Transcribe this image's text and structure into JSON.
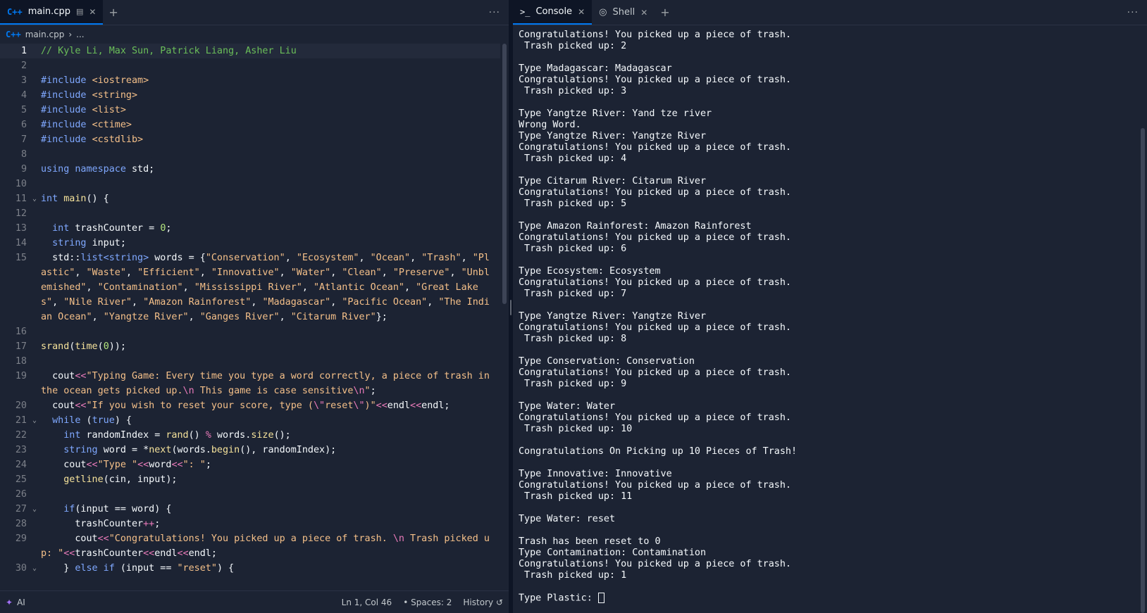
{
  "editor": {
    "tab": {
      "label": "main.cpp",
      "icon": "cpp-file-icon"
    },
    "breadcrumb": {
      "file": "main.cpp",
      "rest": "..."
    },
    "status": {
      "ai_label": "AI",
      "position": "Ln 1, Col 46",
      "spaces": "Spaces: 2",
      "history": "History"
    },
    "lines": [
      {
        "n": "1",
        "fold": false,
        "segs": [
          [
            "com",
            "// Kyle Li, Max Sun, Patrick Liang, Asher Liu"
          ]
        ]
      },
      {
        "n": "2",
        "fold": false,
        "segs": []
      },
      {
        "n": "3",
        "fold": false,
        "segs": [
          [
            "inc",
            "#include "
          ],
          [
            "hdr",
            "<iostream>"
          ]
        ]
      },
      {
        "n": "4",
        "fold": false,
        "segs": [
          [
            "inc",
            "#include "
          ],
          [
            "hdr",
            "<string>"
          ]
        ]
      },
      {
        "n": "5",
        "fold": false,
        "segs": [
          [
            "inc",
            "#include "
          ],
          [
            "hdr",
            "<list>"
          ]
        ]
      },
      {
        "n": "6",
        "fold": false,
        "segs": [
          [
            "inc",
            "#include "
          ],
          [
            "hdr",
            "<ctime>"
          ]
        ]
      },
      {
        "n": "7",
        "fold": false,
        "segs": [
          [
            "inc",
            "#include "
          ],
          [
            "hdr",
            "<cstdlib>"
          ]
        ]
      },
      {
        "n": "8",
        "fold": false,
        "segs": []
      },
      {
        "n": "9",
        "fold": false,
        "segs": [
          [
            "kw",
            "using namespace "
          ],
          [
            "",
            "std;"
          ]
        ]
      },
      {
        "n": "10",
        "fold": false,
        "segs": []
      },
      {
        "n": "11",
        "fold": true,
        "segs": [
          [
            "kw",
            "int "
          ],
          [
            "fn",
            "main"
          ],
          [
            "",
            "() {"
          ]
        ]
      },
      {
        "n": "12",
        "fold": false,
        "segs": []
      },
      {
        "n": "13",
        "fold": false,
        "segs": [
          [
            "",
            "  "
          ],
          [
            "kw",
            "int "
          ],
          [
            "",
            "trashCounter = "
          ],
          [
            "num",
            "0"
          ],
          [
            "",
            ";"
          ]
        ]
      },
      {
        "n": "14",
        "fold": false,
        "segs": [
          [
            "",
            "  "
          ],
          [
            "kw",
            "string "
          ],
          [
            "",
            "input;"
          ]
        ]
      },
      {
        "n": "15",
        "fold": false,
        "segs": [
          [
            "",
            "  std::"
          ],
          [
            "type",
            "list<string> "
          ],
          [
            "",
            "words = {"
          ],
          [
            "str",
            "\"Conservation\""
          ],
          [
            "",
            ", "
          ],
          [
            "str",
            "\"Ecosystem\""
          ],
          [
            "",
            ", "
          ],
          [
            "str",
            "\"Ocean\""
          ],
          [
            "",
            ", "
          ],
          [
            "str",
            "\"Trash\""
          ],
          [
            "",
            ", "
          ],
          [
            "str",
            "\"Plastic\""
          ],
          [
            "",
            ", "
          ],
          [
            "str",
            "\"Waste\""
          ],
          [
            "",
            ", "
          ],
          [
            "str",
            "\"Efficient\""
          ],
          [
            "",
            ", "
          ],
          [
            "str",
            "\"Innovative\""
          ],
          [
            "",
            ", "
          ],
          [
            "str",
            "\"Water\""
          ],
          [
            "",
            ", "
          ],
          [
            "str",
            "\"Clean\""
          ],
          [
            "",
            ", "
          ],
          [
            "str",
            "\"Preserve\""
          ],
          [
            "",
            ", "
          ],
          [
            "str",
            "\"Unblemished\""
          ],
          [
            "",
            ", "
          ],
          [
            "str",
            "\"Contamination\""
          ],
          [
            "",
            ", "
          ],
          [
            "str",
            "\"Mississippi River\""
          ],
          [
            "",
            ", "
          ],
          [
            "str",
            "\"Atlantic Ocean\""
          ],
          [
            "",
            ", "
          ],
          [
            "str",
            "\"Great Lakes\""
          ],
          [
            "",
            ", "
          ],
          [
            "str",
            "\"Nile River\""
          ],
          [
            "",
            ", "
          ],
          [
            "str",
            "\"Amazon Rainforest\""
          ],
          [
            "",
            ", "
          ],
          [
            "str",
            "\"Madagascar\""
          ],
          [
            "",
            ", "
          ],
          [
            "str",
            "\"Pacific Ocean\""
          ],
          [
            "",
            ", "
          ],
          [
            "str",
            "\"The Indian Ocean\""
          ],
          [
            "",
            ", "
          ],
          [
            "str",
            "\"Yangtze River\""
          ],
          [
            "",
            ", "
          ],
          [
            "str",
            "\"Ganges River\""
          ],
          [
            "",
            ", "
          ],
          [
            "str",
            "\"Citarum River\""
          ],
          [
            "",
            "};"
          ]
        ]
      },
      {
        "n": "16",
        "fold": false,
        "segs": []
      },
      {
        "n": "17",
        "fold": false,
        "segs": [
          [
            "fn",
            "srand"
          ],
          [
            "",
            "("
          ],
          [
            "fn",
            "time"
          ],
          [
            "",
            "("
          ],
          [
            "num",
            "0"
          ],
          [
            "",
            "));"
          ]
        ]
      },
      {
        "n": "18",
        "fold": false,
        "segs": []
      },
      {
        "n": "19",
        "fold": false,
        "segs": [
          [
            "",
            "  cout"
          ],
          [
            "op",
            "<<"
          ],
          [
            "str",
            "\"Typing Game: Every time you type a word correctly, a piece of trash in the ocean gets picked up."
          ],
          [
            "esc",
            "\\n"
          ],
          [
            "str",
            " This game is case sensitive"
          ],
          [
            "esc",
            "\\n"
          ],
          [
            "str",
            "\""
          ],
          [
            "",
            ";"
          ]
        ]
      },
      {
        "n": "20",
        "fold": false,
        "segs": [
          [
            "",
            "  cout"
          ],
          [
            "op",
            "<<"
          ],
          [
            "str",
            "\"If you wish to reset your score, type ("
          ],
          [
            "esc",
            "\\\""
          ],
          [
            "str",
            "reset"
          ],
          [
            "esc",
            "\\\""
          ],
          [
            "str",
            ")\""
          ],
          [
            "op",
            "<<"
          ],
          [
            "",
            "endl"
          ],
          [
            "op",
            "<<"
          ],
          [
            "",
            "endl;"
          ]
        ]
      },
      {
        "n": "21",
        "fold": true,
        "segs": [
          [
            "",
            "  "
          ],
          [
            "kw",
            "while "
          ],
          [
            "",
            "("
          ],
          [
            "kw",
            "true"
          ],
          [
            "",
            ") {"
          ]
        ]
      },
      {
        "n": "22",
        "fold": false,
        "segs": [
          [
            "",
            "    "
          ],
          [
            "kw",
            "int "
          ],
          [
            "",
            "randomIndex = "
          ],
          [
            "fn",
            "rand"
          ],
          [
            "",
            "() "
          ],
          [
            "op",
            "% "
          ],
          [
            "",
            "words."
          ],
          [
            "fn",
            "size"
          ],
          [
            "",
            "();"
          ]
        ]
      },
      {
        "n": "23",
        "fold": false,
        "segs": [
          [
            "",
            "    "
          ],
          [
            "kw",
            "string "
          ],
          [
            "",
            "word = *"
          ],
          [
            "fn",
            "next"
          ],
          [
            "",
            "(words."
          ],
          [
            "fn",
            "begin"
          ],
          [
            "",
            "(), randomIndex);"
          ]
        ]
      },
      {
        "n": "24",
        "fold": false,
        "segs": [
          [
            "",
            "    cout"
          ],
          [
            "op",
            "<<"
          ],
          [
            "str",
            "\"Type \""
          ],
          [
            "op",
            "<<"
          ],
          [
            "",
            "word"
          ],
          [
            "op",
            "<<"
          ],
          [
            "str",
            "\": \""
          ],
          [
            "",
            ";"
          ]
        ]
      },
      {
        "n": "25",
        "fold": false,
        "segs": [
          [
            "",
            "    "
          ],
          [
            "fn",
            "getline"
          ],
          [
            "",
            "(cin, input);"
          ]
        ]
      },
      {
        "n": "26",
        "fold": false,
        "segs": []
      },
      {
        "n": "27",
        "fold": true,
        "segs": [
          [
            "",
            "    "
          ],
          [
            "kw",
            "if"
          ],
          [
            "",
            "(input == word) {"
          ]
        ]
      },
      {
        "n": "28",
        "fold": false,
        "segs": [
          [
            "",
            "      trashCounter"
          ],
          [
            "op",
            "++"
          ],
          [
            "",
            ";"
          ]
        ]
      },
      {
        "n": "29",
        "fold": false,
        "segs": [
          [
            "",
            "      cout"
          ],
          [
            "op",
            "<<"
          ],
          [
            "str",
            "\"Congratulations! You picked up a piece of trash. "
          ],
          [
            "esc",
            "\\n"
          ],
          [
            "str",
            " Trash picked up: \""
          ],
          [
            "op",
            "<<"
          ],
          [
            "",
            "trashCounter"
          ],
          [
            "op",
            "<<"
          ],
          [
            "",
            "endl"
          ],
          [
            "op",
            "<<"
          ],
          [
            "",
            "endl;"
          ]
        ]
      },
      {
        "n": "30",
        "fold": true,
        "segs": [
          [
            "",
            "    } "
          ],
          [
            "kw",
            "else if "
          ],
          [
            "",
            "(input == "
          ],
          [
            "str",
            "\"reset\""
          ],
          [
            "",
            ") {"
          ]
        ]
      }
    ]
  },
  "console": {
    "tabs": [
      {
        "label": "Console",
        "icon": "terminal-icon",
        "active": true
      },
      {
        "label": "Shell",
        "icon": "shell-icon",
        "active": false
      }
    ],
    "lines": [
      "Congratulations! You picked up a piece of trash.",
      " Trash picked up: 2",
      "",
      "Type Madagascar: Madagascar",
      "Congratulations! You picked up a piece of trash.",
      " Trash picked up: 3",
      "",
      "Type Yangtze River: Yand tze river",
      "Wrong Word.",
      "Type Yangtze River: Yangtze River",
      "Congratulations! You picked up a piece of trash.",
      " Trash picked up: 4",
      "",
      "Type Citarum River: Citarum River",
      "Congratulations! You picked up a piece of trash.",
      " Trash picked up: 5",
      "",
      "Type Amazon Rainforest: Amazon Rainforest",
      "Congratulations! You picked up a piece of trash.",
      " Trash picked up: 6",
      "",
      "Type Ecosystem: Ecosystem",
      "Congratulations! You picked up a piece of trash.",
      " Trash picked up: 7",
      "",
      "Type Yangtze River: Yangtze River",
      "Congratulations! You picked up a piece of trash.",
      " Trash picked up: 8",
      "",
      "Type Conservation: Conservation",
      "Congratulations! You picked up a piece of trash.",
      " Trash picked up: 9",
      "",
      "Type Water: Water",
      "Congratulations! You picked up a piece of trash.",
      " Trash picked up: 10",
      "",
      "Congratulations On Picking up 10 Pieces of Trash!",
      "",
      "Type Innovative: Innovative",
      "Congratulations! You picked up a piece of trash.",
      " Trash picked up: 11",
      "",
      "Type Water: reset",
      "",
      "Trash has been reset to 0",
      "Type Contamination: Contamination",
      "Congratulations! You picked up a piece of trash.",
      " Trash picked up: 1",
      ""
    ],
    "prompt": "Type Plastic: "
  },
  "colors": {
    "background": "#1c2333",
    "accent": "#0079f2",
    "comment": "#6bbf59",
    "keyword": "#7fa8ff",
    "string": "#f5c089"
  }
}
